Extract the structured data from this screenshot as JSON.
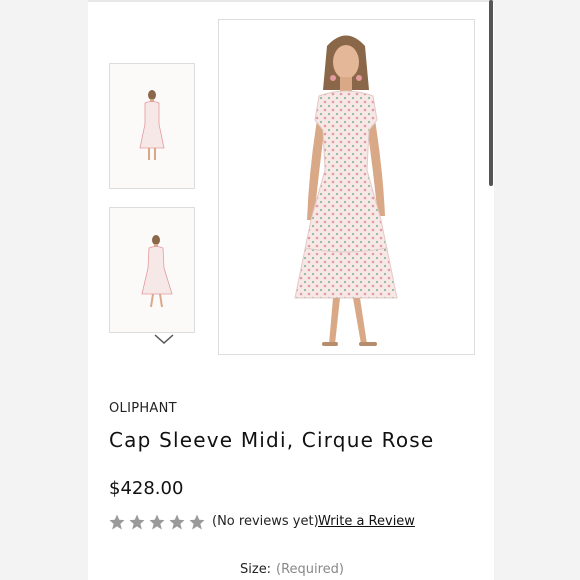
{
  "product": {
    "brand": "OLIPHANT",
    "title": "Cap Sleeve Midi, Cirque Rose",
    "price": "$428.00",
    "rating_stars": 5,
    "reviews_text": "(No reviews yet)",
    "write_review_label": "Write a Review"
  },
  "options": {
    "size_label": "Size:",
    "size_required": "(Required)"
  },
  "gallery": {
    "thumbnail_count": 2,
    "next_icon": "chevron-down-icon"
  },
  "colors": {
    "dress": "#f6e8e6",
    "pattern": "#e59aa0",
    "pattern_alt": "#8fb89a",
    "skin": "#d9a987",
    "hair": "#8a6748",
    "star": "#9a9a9a"
  }
}
